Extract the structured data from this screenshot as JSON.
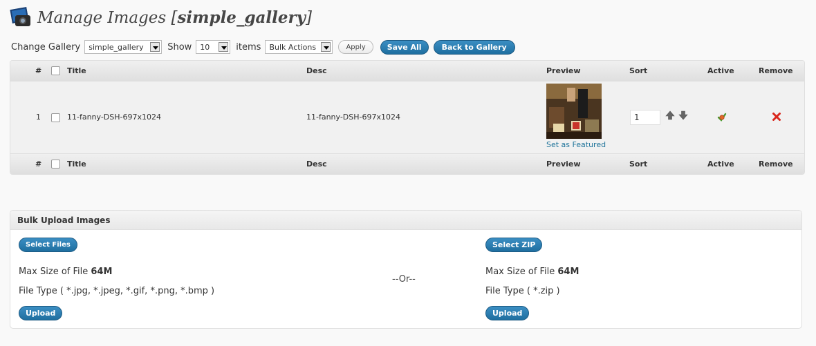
{
  "page": {
    "title_prefix": "Manage Images [",
    "gallery_name": "simple_gallery",
    "title_suffix": "]"
  },
  "toolbar": {
    "change_gallery_label": "Change Gallery",
    "gallery_select_value": "simple_gallery",
    "show_label": "Show",
    "show_select_value": "10",
    "items_label": "items",
    "bulk_actions_value": "Bulk Actions",
    "apply_label": "Apply",
    "save_all_label": "Save All",
    "back_label": "Back to Gallery"
  },
  "table": {
    "columns": [
      "#",
      "Title",
      "Desc",
      "Preview",
      "Sort",
      "Active",
      "Remove"
    ],
    "rows": [
      {
        "num": "1",
        "title": "11-fanny-DSH-697x1024",
        "desc": "11-fanny-DSH-697x1024",
        "featured_link": "Set as Featured",
        "sort": "1"
      }
    ]
  },
  "upload": {
    "heading": "Bulk Upload Images",
    "select_files_label": "Select Files",
    "select_zip_label": "Select ZIP",
    "max_size_prefix": "Max Size of File",
    "max_size_value": "64M",
    "file_types_images": "File Type ( *.jpg, *.jpeg, *.gif, *.png, *.bmp )",
    "file_types_zip": "File Type ( *.zip )",
    "or_label": "--Or--",
    "upload_label": "Upload"
  },
  "colors": {
    "accent_blue": "#21759b",
    "button_blue": "#2a7db5",
    "remove_red": "#d9261c"
  }
}
